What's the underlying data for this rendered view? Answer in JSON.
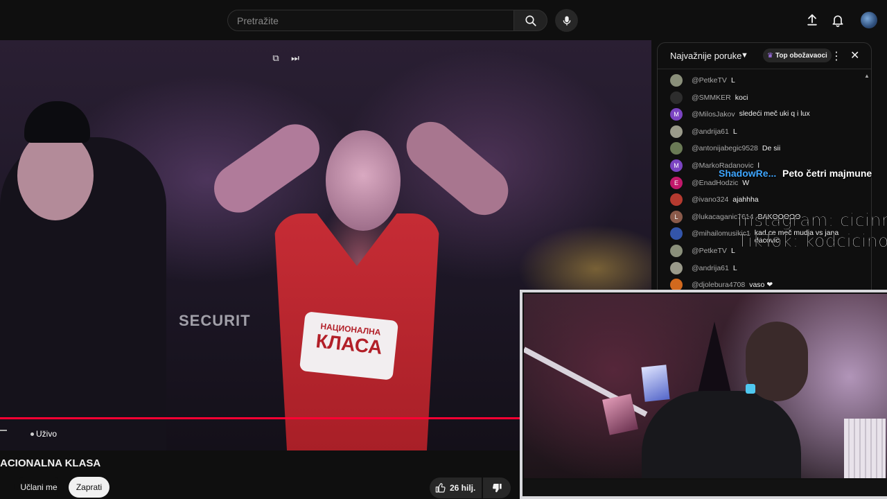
{
  "search": {
    "placeholder": "Pretražite"
  },
  "video": {
    "jersey_text_line1": "НАЦИОНАЛНА",
    "jersey_text_line2": "КЛАСА",
    "background_text": "SECURIT",
    "live_label": "Uživo",
    "progress_color": "#ff0033"
  },
  "below_video": {
    "title": "ACIONALNA KLASA",
    "join_label": "Učlani me",
    "subscribe_label": "Zaprati",
    "likes": "26 hilj."
  },
  "chat": {
    "header_title": "Najvažnije poruke",
    "top_fans_label": "Top obožavaoci",
    "messages": [
      {
        "author": "@PetkeTV",
        "text": "L",
        "avatar": "",
        "color": "#8a8f7a"
      },
      {
        "author": "@SMMKER",
        "text": "koci",
        "avatar": "",
        "color": "#2d2d2d"
      },
      {
        "author": "@MilosJakov",
        "text": "sledeći meč uki q i lux",
        "avatar": "M",
        "color": "#7b44c2"
      },
      {
        "author": "@andrija61",
        "text": "L",
        "avatar": "",
        "color": "#9a9a8a"
      },
      {
        "author": "@antonijabegic9528",
        "text": "De sii",
        "avatar": "",
        "color": "#6a7a55"
      },
      {
        "author": "@MarkoRadanovic",
        "text": "l",
        "avatar": "M",
        "color": "#7b44c2"
      },
      {
        "author": "@EnadHodzic",
        "text": "W",
        "avatar": "E",
        "color": "#c2186b"
      },
      {
        "author": "@ivano324",
        "text": "ajahhha",
        "avatar": "",
        "color": "#b53a2f"
      },
      {
        "author": "@lukacaganic7614",
        "text": "BAKOOOOO",
        "avatar": "L",
        "color": "#8a5a4a"
      },
      {
        "author": "@mihailomusikic1",
        "text": "kad ce meč mudja vs jana dacovic",
        "avatar": "",
        "color": "#3355aa"
      },
      {
        "author": "@PetkeTV",
        "text": "L",
        "avatar": "",
        "color": "#8a8f7a"
      },
      {
        "author": "@andrija61",
        "text": "L",
        "avatar": "",
        "color": "#9a9a8a"
      },
      {
        "author": "@djolebura4708",
        "text": "vaso ❤",
        "avatar": "",
        "color": "#d2691e"
      }
    ]
  },
  "overlay": {
    "shadow_name": "ShadowRe...",
    "shadow_msg": "Peto četri majmune",
    "instagram": "Instagram: cicinmg",
    "tiktok": "TikTok: kodcicinog"
  },
  "icons": {
    "search": "search-icon",
    "mic": "mic-icon",
    "upload": "upload-icon",
    "bell": "bell-icon",
    "like": "thumb-up-icon",
    "dislike": "thumb-down-icon"
  }
}
